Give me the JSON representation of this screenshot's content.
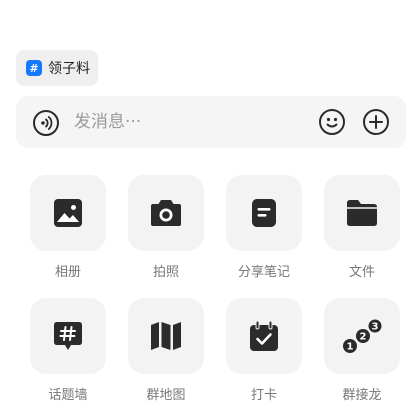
{
  "tag_chip": {
    "icon": "#",
    "label": "领子料"
  },
  "composer": {
    "placeholder": "发消息···",
    "value": ""
  },
  "actions": [
    {
      "label": "相册",
      "icon": "image-icon"
    },
    {
      "label": "拍照",
      "icon": "camera-icon"
    },
    {
      "label": "分享笔记",
      "icon": "note-icon"
    },
    {
      "label": "文件",
      "icon": "folder-icon"
    },
    {
      "label": "话题墙",
      "icon": "topic-icon"
    },
    {
      "label": "群地图",
      "icon": "map-icon"
    },
    {
      "label": "打卡",
      "icon": "checkin-icon"
    },
    {
      "label": "群接龙",
      "icon": "chain-icon"
    }
  ],
  "colors": {
    "accent": "#1677ff",
    "icon": "#2b2b2b",
    "tile_bg": "#f3f3f3"
  }
}
